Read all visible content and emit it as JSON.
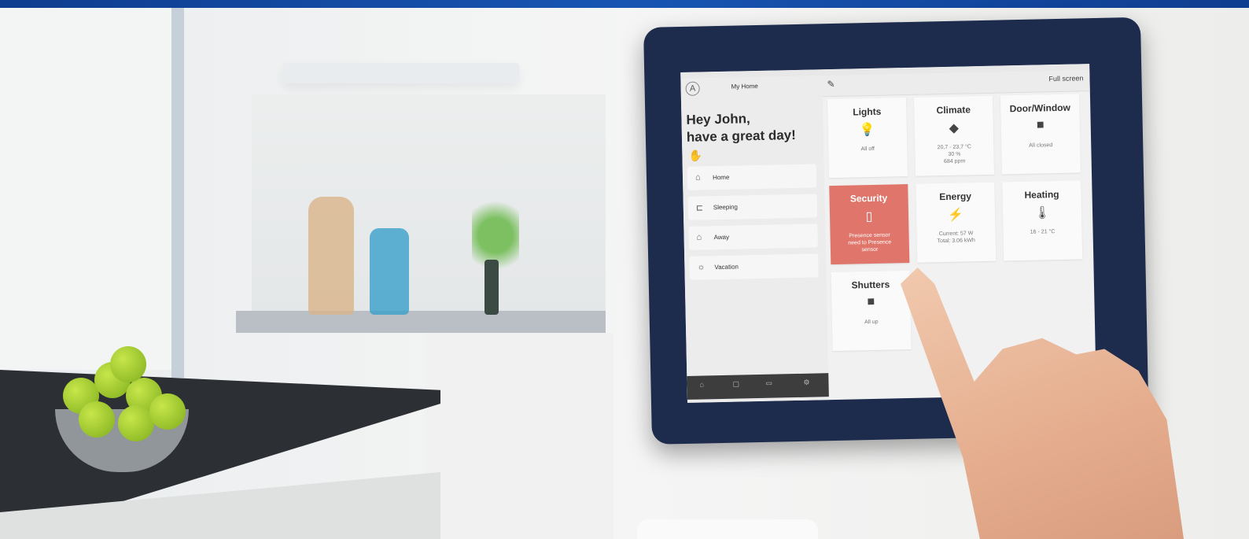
{
  "tablet": {
    "topbar": {
      "avatar": "A",
      "home_name": "My Home",
      "edit_icon": "pencil-icon",
      "fullscreen_label": "Full screen"
    },
    "greeting": {
      "line1": "Hey John,",
      "line2": "have a great day!",
      "icon": "waving-hand-icon"
    },
    "scenes": [
      {
        "label": "Home",
        "icon": "home-icon"
      },
      {
        "label": "Sleeping",
        "icon": "bed-icon"
      },
      {
        "label": "Away",
        "icon": "house-outline-icon"
      },
      {
        "label": "Vacation",
        "icon": "sun-icon"
      }
    ],
    "tiles": [
      {
        "title": "Lights",
        "icon": "bulb-icon",
        "status": "All off"
      },
      {
        "title": "Climate",
        "icon": "leaf-icon",
        "status": "20,7 - 23,7 °C\n30 %\n684 ppm"
      },
      {
        "title": "Door/Window",
        "icon": "door-icon",
        "status": "All closed"
      },
      {
        "title": "Security",
        "icon": "battery-icon",
        "status": "Presence sensor\nneed to Presence\nsensor",
        "alert": true,
        "alert_color": "#e0766b"
      },
      {
        "title": "Energy",
        "icon": "lightning-icon",
        "status": "Current: 57 W\nTotal: 3.06 kWh"
      },
      {
        "title": "Heating",
        "icon": "thermometer-icon",
        "status": "16 - 21 °C"
      },
      {
        "title": "Shutters",
        "icon": "shutter-icon",
        "status": "All up"
      }
    ]
  }
}
